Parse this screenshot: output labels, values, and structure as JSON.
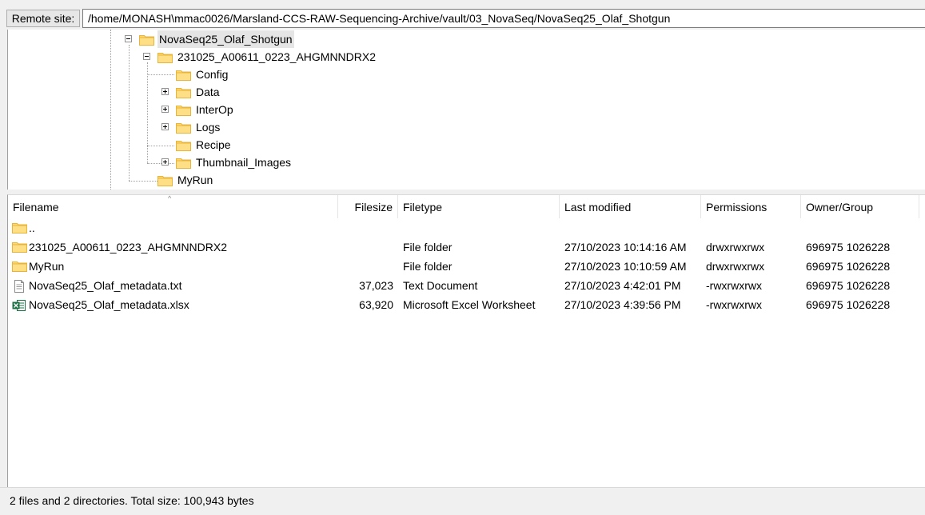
{
  "remote_site": {
    "label": "Remote site:",
    "path": "/home/MONASH\\mmac0026/Marsland-CCS-RAW-Sequencing-Archive/vault/03_NovaSeq/NovaSeq25_Olaf_Shotgun"
  },
  "tree": {
    "nodes": [
      {
        "label": "NovaSeq25_Olaf_Shotgun",
        "expander": "minus",
        "selected": true
      },
      {
        "label": "231025_A00611_0223_AHGMNNDRX2",
        "expander": "minus"
      },
      {
        "label": "Config",
        "expander": "none"
      },
      {
        "label": "Data",
        "expander": "plus"
      },
      {
        "label": "InterOp",
        "expander": "plus"
      },
      {
        "label": "Logs",
        "expander": "plus"
      },
      {
        "label": "Recipe",
        "expander": "none"
      },
      {
        "label": "Thumbnail_Images",
        "expander": "plus"
      },
      {
        "label": "MyRun",
        "expander": "none"
      }
    ]
  },
  "file_list": {
    "columns": {
      "filename": "Filename",
      "filesize": "Filesize",
      "filetype": "Filetype",
      "last_modified": "Last modified",
      "permissions": "Permissions",
      "owner_group": "Owner/Group"
    },
    "rows": [
      {
        "icon": "folder-icon",
        "name": "..",
        "size": "",
        "type": "",
        "modified": "",
        "perms": "",
        "owner": ""
      },
      {
        "icon": "folder-icon",
        "name": "231025_A00611_0223_AHGMNNDRX2",
        "size": "",
        "type": "File folder",
        "modified": "27/10/2023 10:14:16 AM",
        "perms": "drwxrwxrwx",
        "owner": "696975 1026228"
      },
      {
        "icon": "folder-icon",
        "name": "MyRun",
        "size": "",
        "type": "File folder",
        "modified": "27/10/2023 10:10:59 AM",
        "perms": "drwxrwxrwx",
        "owner": "696975 1026228"
      },
      {
        "icon": "text-file-icon",
        "name": "NovaSeq25_Olaf_metadata.txt",
        "size": "37,023",
        "type": "Text Document",
        "modified": "27/10/2023 4:42:01 PM",
        "perms": "-rwxrwxrwx",
        "owner": "696975 1026228"
      },
      {
        "icon": "excel-file-icon",
        "name": "NovaSeq25_Olaf_metadata.xlsx",
        "size": "63,920",
        "type": "Microsoft Excel Worksheet",
        "modified": "27/10/2023 4:39:56 PM",
        "perms": "-rwxrwxrwx",
        "owner": "696975 1026228"
      }
    ]
  },
  "status": {
    "text": "2 files and 2 directories. Total size: 100,943 bytes"
  },
  "colors": {
    "folder_fill": "#ffd86e",
    "folder_dark": "#e8b43a",
    "excel_green": "#1d7044"
  }
}
